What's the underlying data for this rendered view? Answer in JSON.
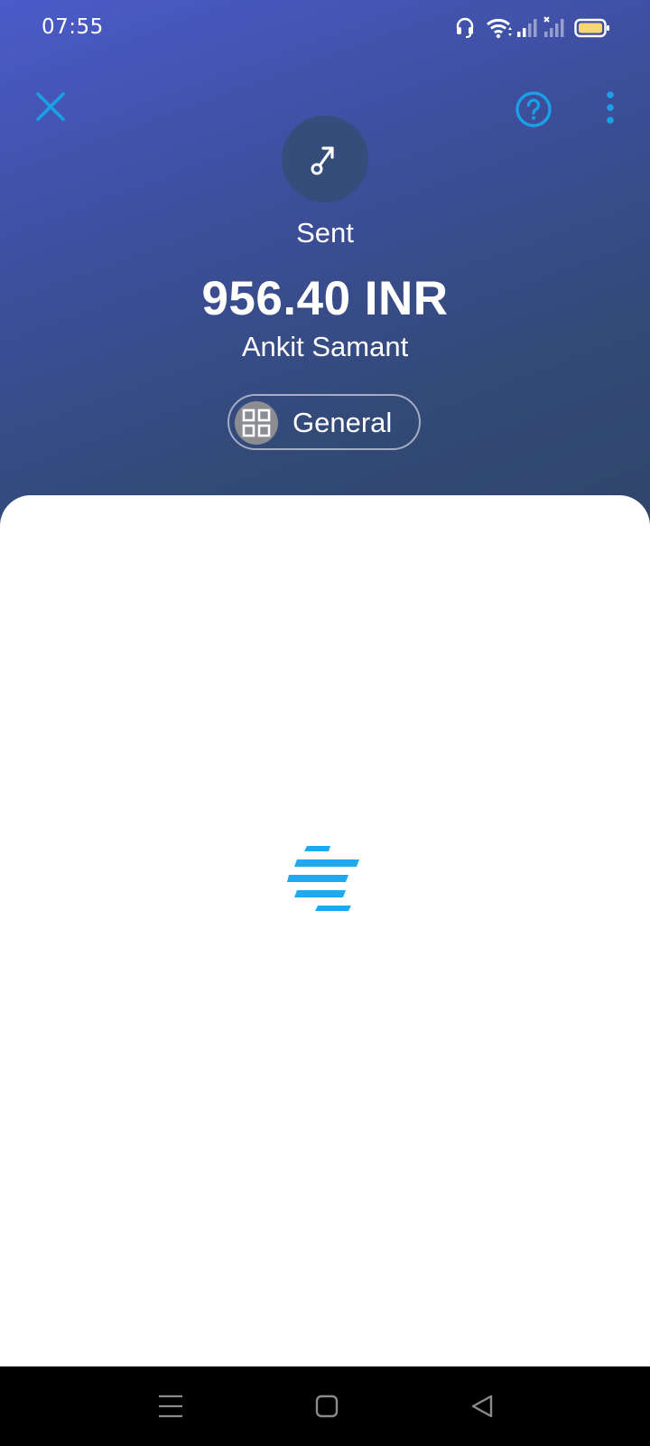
{
  "status_bar": {
    "time": "07:55",
    "icons": [
      "headset-icon",
      "wifi-icon",
      "signal-icon",
      "signal-no-service-icon",
      "battery-icon"
    ]
  },
  "toolbar": {
    "close_icon": "close-icon",
    "help_icon": "help-icon",
    "more_icon": "more-vertical-icon"
  },
  "transaction": {
    "type_icon": "sent-arrow-icon",
    "status": "Sent",
    "amount": "956.40 INR",
    "recipient": "Ankit Samant",
    "category": {
      "icon": "grid-icon",
      "label": "General"
    }
  },
  "content": {
    "loading_icon": "loading-spinner-icon"
  },
  "nav_bar": {
    "icons": [
      "menu-icon",
      "home-icon",
      "back-icon"
    ]
  },
  "colors": {
    "header_gradient_start": "#4a5bc9",
    "header_gradient_end": "#2f4569",
    "accent": "#1aa0e6",
    "loader": "#1eaaf1",
    "sheet": "#ffffff",
    "nav_bar": "#000000"
  }
}
